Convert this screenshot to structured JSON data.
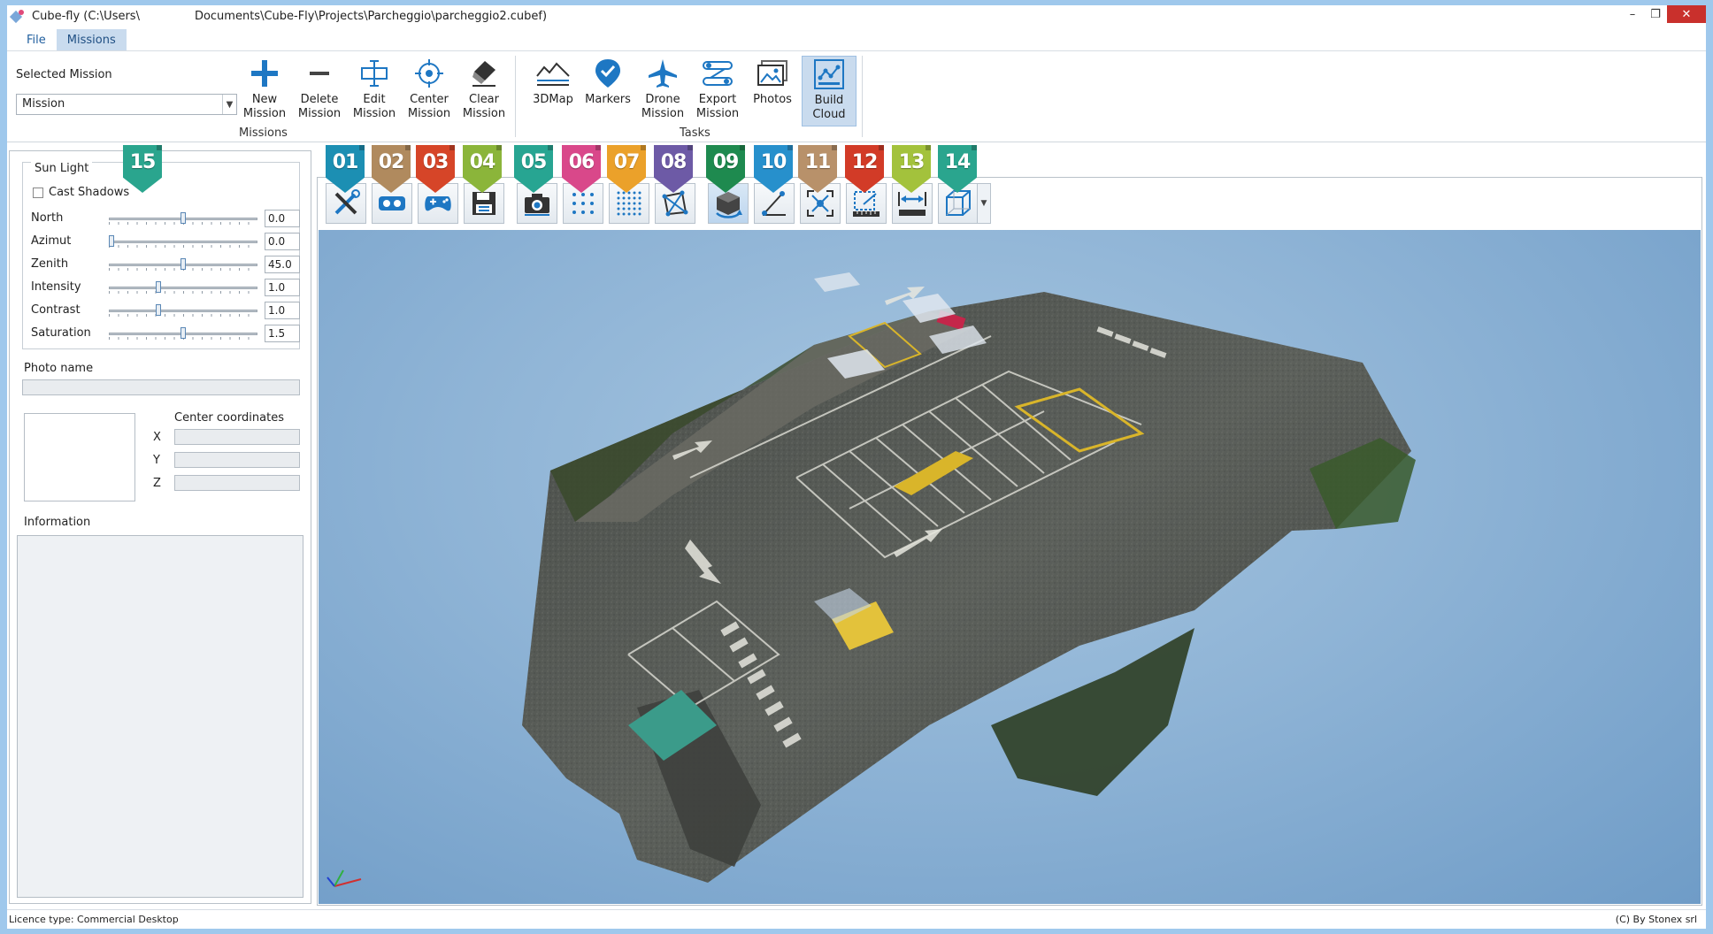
{
  "window": {
    "title": "Cube-fly (C:\\Users\\               Documents\\Cube-Fly\\Projects\\Parcheggio\\parcheggio2.cubef)"
  },
  "menu": {
    "file": "File",
    "missions": "Missions"
  },
  "ribbon": {
    "selected_mission_label": "Selected Mission",
    "mission_value": "Mission",
    "missions_group": "Missions",
    "tasks_group": "Tasks",
    "buttons": {
      "new_mission": "New Mission",
      "delete_mission": "Delete Mission",
      "edit_mission": "Edit Mission",
      "center_mission": "Center Mission",
      "clear_mission": "Clear Mission",
      "map3d": "3DMap",
      "markers": "Markers",
      "drone_mission": "Drone Mission",
      "export_mission": "Export Mission",
      "photos": "Photos",
      "build_cloud": "Build Cloud"
    }
  },
  "sun_light": {
    "title": "Sun Light",
    "cast_shadows": "Cast Shadows",
    "sliders": [
      {
        "label": "North",
        "value": "0.0",
        "position": 0.5
      },
      {
        "label": "Azimut",
        "value": "0.0",
        "position": 0.0
      },
      {
        "label": "Zenith",
        "value": "45.0",
        "position": 0.5
      },
      {
        "label": "Intensity",
        "value": "1.0",
        "position": 0.33
      },
      {
        "label": "Contrast",
        "value": "1.0",
        "position": 0.33
      },
      {
        "label": "Saturation",
        "value": "1.5",
        "position": 0.5
      }
    ]
  },
  "photo": {
    "name_label": "Photo name",
    "center_coordinates": "Center coordinates",
    "x": "X",
    "y": "Y",
    "z": "Z"
  },
  "information_label": "Information",
  "badges": [
    {
      "num": "15",
      "color": "#2aa58e"
    },
    {
      "num": "01",
      "color": "#1c8fb3"
    },
    {
      "num": "02",
      "color": "#b08a5e"
    },
    {
      "num": "03",
      "color": "#d64528"
    },
    {
      "num": "04",
      "color": "#8bb53a"
    },
    {
      "num": "05",
      "color": "#27a592"
    },
    {
      "num": "06",
      "color": "#d9488a"
    },
    {
      "num": "07",
      "color": "#eba12a"
    },
    {
      "num": "08",
      "color": "#6d5aa6"
    },
    {
      "num": "09",
      "color": "#1e8a4f"
    },
    {
      "num": "10",
      "color": "#2790cc"
    },
    {
      "num": "11",
      "color": "#b8916a"
    },
    {
      "num": "12",
      "color": "#d23b27"
    },
    {
      "num": "13",
      "color": "#a3c23c"
    },
    {
      "num": "14",
      "color": "#2aa58e"
    }
  ],
  "status": {
    "licence": "Licence type: Commercial Desktop",
    "copyright": "(C) By Stonex srl"
  }
}
